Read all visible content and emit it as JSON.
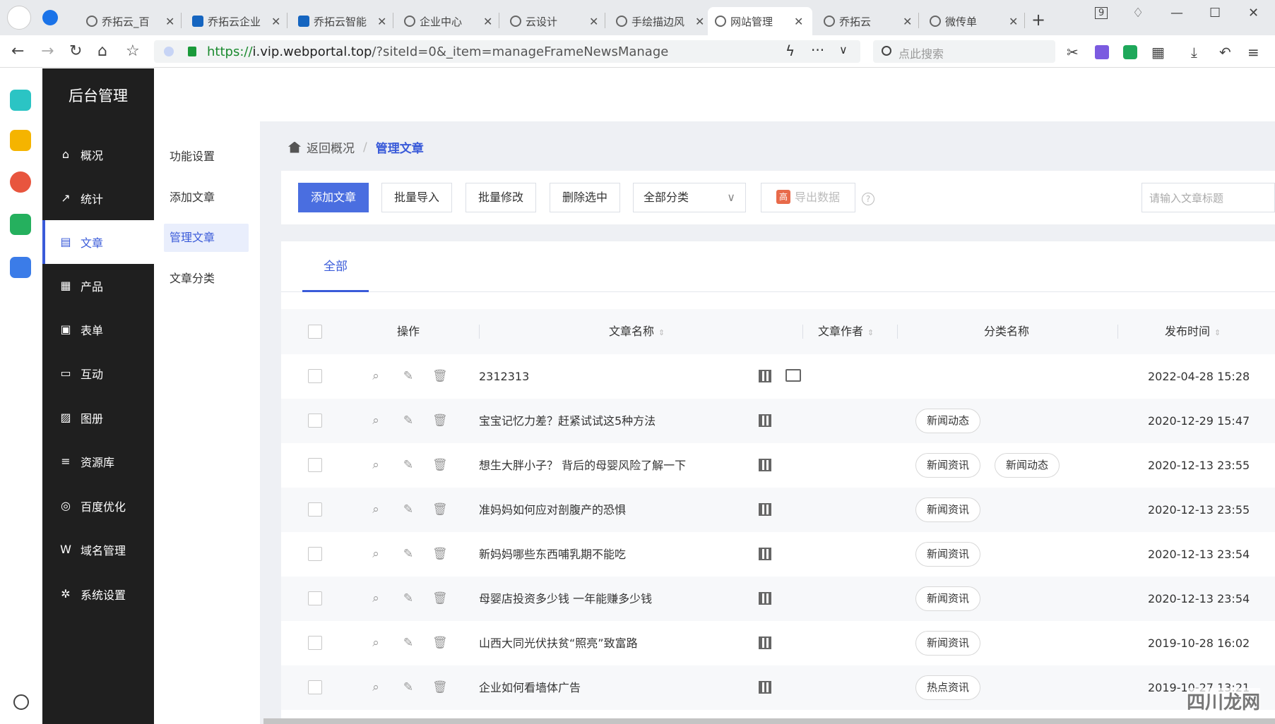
{
  "browser": {
    "tabs": [
      {
        "label": "乔拓云_百"
      },
      {
        "label": "乔拓云企业"
      },
      {
        "label": "乔拓云智能"
      },
      {
        "label": "企业中心"
      },
      {
        "label": "云设计"
      },
      {
        "label": "手绘描边风"
      },
      {
        "label": "网站管理"
      },
      {
        "label": "乔拓云"
      },
      {
        "label": "微传单"
      }
    ],
    "tab_count": "9",
    "url_scheme": "https://",
    "url_host": "i.vip.webportal.top",
    "url_path": "/?siteId=0&_item=manageFrameNewsManage",
    "search_placeholder": "点此搜索"
  },
  "sidebar": {
    "brand": "后台管理",
    "items": [
      {
        "label": "概况",
        "icon": "home-icon",
        "glyph": "⌂"
      },
      {
        "label": "统计",
        "icon": "chart-icon",
        "glyph": "↗"
      },
      {
        "label": "文章",
        "icon": "article-icon",
        "glyph": "▤"
      },
      {
        "label": "产品",
        "icon": "grid-icon",
        "glyph": "▦"
      },
      {
        "label": "表单",
        "icon": "calendar-icon",
        "glyph": "▣"
      },
      {
        "label": "互动",
        "icon": "chat-icon",
        "glyph": "▭"
      },
      {
        "label": "图册",
        "icon": "album-icon",
        "glyph": "▨"
      },
      {
        "label": "资源库",
        "icon": "database-icon",
        "glyph": "≡"
      },
      {
        "label": "百度优化",
        "icon": "target-icon",
        "glyph": "◎"
      },
      {
        "label": "域名管理",
        "icon": "domain-icon",
        "glyph": "W"
      },
      {
        "label": "系统设置",
        "icon": "gear-icon",
        "glyph": "✲"
      }
    ]
  },
  "subnav": {
    "items": [
      "功能设置",
      "添加文章",
      "管理文章",
      "文章分类"
    ]
  },
  "breadcrumb": {
    "back": "返回概况",
    "sep": "/",
    "current": "管理文章"
  },
  "toolbar": {
    "add": "添加文章",
    "import": "批量导入",
    "batch_edit": "批量修改",
    "delete_selected": "删除选中",
    "category_select": "全部分类",
    "export_badge": "高",
    "export": "导出数据",
    "help": "?",
    "title_placeholder": "请输入文章标题"
  },
  "tabs": {
    "all": "全部"
  },
  "table": {
    "columns": {
      "action": "操作",
      "title": "文章名称",
      "author": "文章作者",
      "category": "分类名称",
      "date": "发布时间"
    },
    "rows": [
      {
        "title": "2312313",
        "tags": [],
        "date": "2022-04-28 15:28"
      },
      {
        "title": "宝宝记忆力差？赶紧试试这5种方法",
        "tags": [
          "新闻动态"
        ],
        "date": "2020-12-29 15:47"
      },
      {
        "title": "想生大胖小子？ 背后的母婴风险了解一下",
        "tags": [
          "新闻资讯",
          "新闻动态"
        ],
        "date": "2020-12-13 23:55"
      },
      {
        "title": "准妈妈如何应对剖腹产的恐惧",
        "tags": [
          "新闻资讯"
        ],
        "date": "2020-12-13 23:55"
      },
      {
        "title": "新妈妈哪些东西哺乳期不能吃",
        "tags": [
          "新闻资讯"
        ],
        "date": "2020-12-13 23:54"
      },
      {
        "title": "母婴店投资多少钱 一年能赚多少钱",
        "tags": [
          "新闻资讯"
        ],
        "date": "2020-12-13 23:54"
      },
      {
        "title": "山西大同光伏扶贫“照亮”致富路",
        "tags": [
          "新闻资讯"
        ],
        "date": "2019-10-28 16:02"
      },
      {
        "title": "企业如何看墙体广告",
        "tags": [
          "热点资讯"
        ],
        "date": "2019-10-27 13:21"
      }
    ]
  },
  "watermark": "四川龙网"
}
